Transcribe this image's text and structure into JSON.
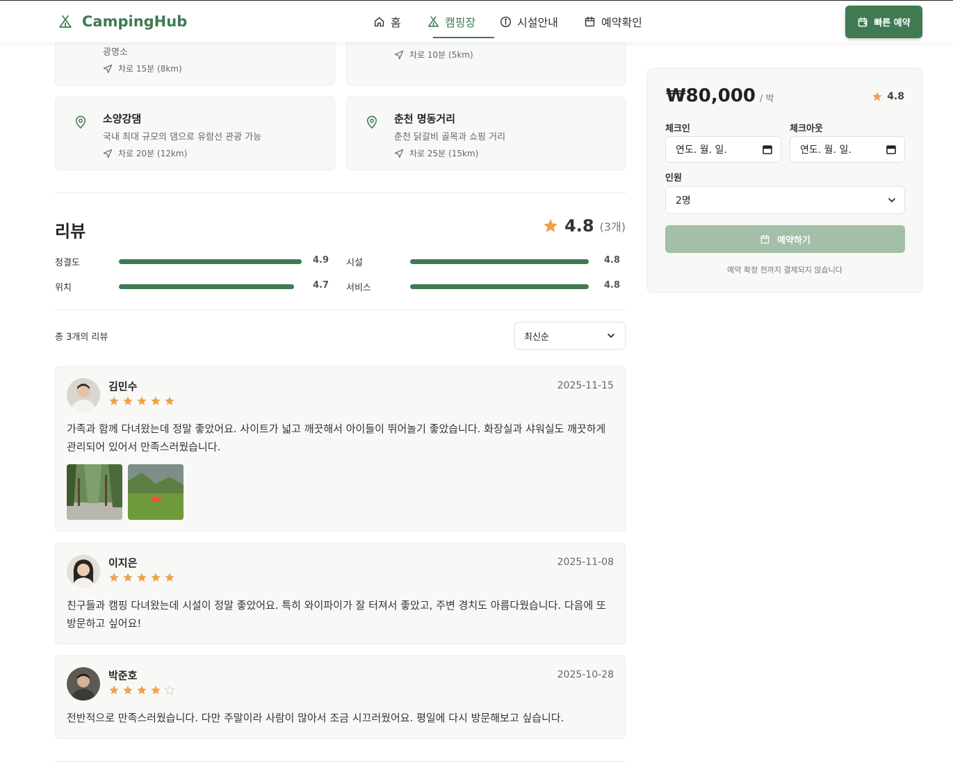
{
  "header": {
    "brand": "CampingHub",
    "nav": [
      {
        "label": "홈",
        "icon": "home-icon"
      },
      {
        "label": "캠핑장",
        "icon": "tent-icon",
        "active": true
      },
      {
        "label": "시설안내",
        "icon": "info-icon"
      },
      {
        "label": "예약확인",
        "icon": "calendar-icon"
      }
    ],
    "quick_booking": "빠른 예약"
  },
  "attractions": [
    {
      "title": "",
      "desc": "광명소",
      "distance": "차로 15분 (8km)"
    },
    {
      "title": "",
      "desc": "",
      "distance": "차로 10분 (5km)"
    },
    {
      "title": "소양강댐",
      "desc": "국내 최대 규모의 댐으로 유람선 관광 가능",
      "distance": "차로 20분 (12km)"
    },
    {
      "title": "춘천 명동거리",
      "desc": "춘천 닭갈비 골목과 쇼핑 거리",
      "distance": "차로 25분 (15km)"
    }
  ],
  "reviews_section": {
    "title": "리뷰",
    "average": "4.8",
    "count_label": "(3개)",
    "categories": [
      {
        "label": "청결도",
        "value": "4.9",
        "score": 4.9
      },
      {
        "label": "시설",
        "value": "4.8",
        "score": 4.8
      },
      {
        "label": "위치",
        "value": "4.7",
        "score": 4.7
      },
      {
        "label": "서비스",
        "value": "4.8",
        "score": 4.8
      }
    ],
    "total_text": "총 3개의 리뷰",
    "sort": {
      "selected": "최신순"
    }
  },
  "reviews": [
    {
      "name": "김민수",
      "rating": 5,
      "date": "2025-11-15",
      "text": "가족과 함께 다녀왔는데 정말 좋았어요. 사이트가 넓고 깨끗해서 아이들이 뛰어놀기 좋았습니다. 화장실과 샤워실도 깨끗하게 관리되어 있어서 만족스러웠습니다.",
      "photos": 2
    },
    {
      "name": "이지은",
      "rating": 5,
      "date": "2025-11-08",
      "text": "친구들과 캠핑 다녀왔는데 시설이 정말 좋았어요. 특히 와이파이가 잘 터져서 좋았고, 주변 경치도 아름다웠습니다. 다음에 또 방문하고 싶어요!",
      "photos": 0
    },
    {
      "name": "박준호",
      "rating": 4,
      "date": "2025-10-28",
      "text": "전반적으로 만족스러웠습니다. 다만 주말이라 사람이 많아서 조금 시끄러웠어요. 평일에 다시 방문해보고 싶습니다.",
      "photos": 0
    }
  ],
  "booking": {
    "price": "₩80,000",
    "unit": "/ 박",
    "rating": "4.8",
    "checkin_label": "체크인",
    "checkin_value": "연도. 월. 일.",
    "checkout_label": "체크아웃",
    "checkout_value": "연도. 월. 일.",
    "guests_label": "인원",
    "guests_value": "2명",
    "submit": "예약하기",
    "note": "예약 확정 전까지 결제되지 않습니다"
  },
  "colors": {
    "primary": "#3f7a52",
    "star": "#f0a24a",
    "disabled_button": "#a3bfa8"
  }
}
